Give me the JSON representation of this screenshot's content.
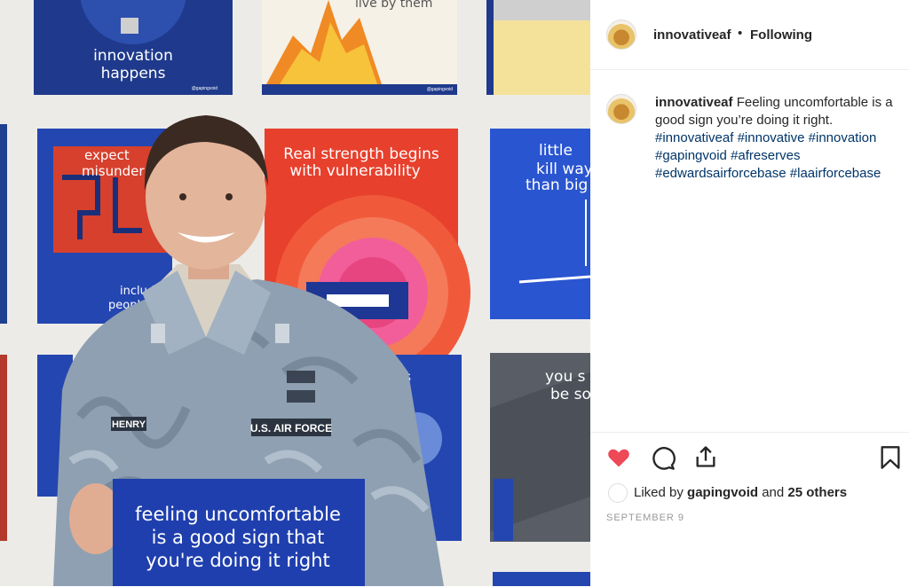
{
  "post": {
    "username": "innovativeaf",
    "follow_label": "Following",
    "caption_text": "Feeling uncomfortable is a good sign you’re doing it right.",
    "hashtags": [
      "#innovativeaf",
      "#innovative",
      "#innovation",
      "#gapingvoid",
      "#afreserves",
      "#edwardsairforcebase",
      "#laairforcebase"
    ],
    "liked_by_prefix": "Liked by",
    "liked_by_user": "gapingvoid",
    "liked_by_and": "and",
    "liked_by_others": "25 others",
    "date": "SEPTEMBER 9",
    "like_color": "#ed4956"
  },
  "photo": {
    "art": {
      "innovation": [
        "innovation",
        "happens"
      ],
      "live": "live by them",
      "expect": [
        "expect",
        "misunder"
      ],
      "strength": [
        "Real strength begins",
        "with vulnerability"
      ],
      "little": [
        "little",
        "kill way",
        "than big"
      ],
      "including": [
        "including",
        "people"
      ],
      "ters": "ters",
      "yousi": [
        "you s",
        "be so"
      ],
      "gapingvoid": "@gapingvoid"
    },
    "uniform": {
      "name": "HENRY",
      "branch": "U.S. AIR FORCE"
    },
    "sign": [
      "feeling uncomfortable",
      "is a good sign that",
      "you're doing it right"
    ]
  }
}
